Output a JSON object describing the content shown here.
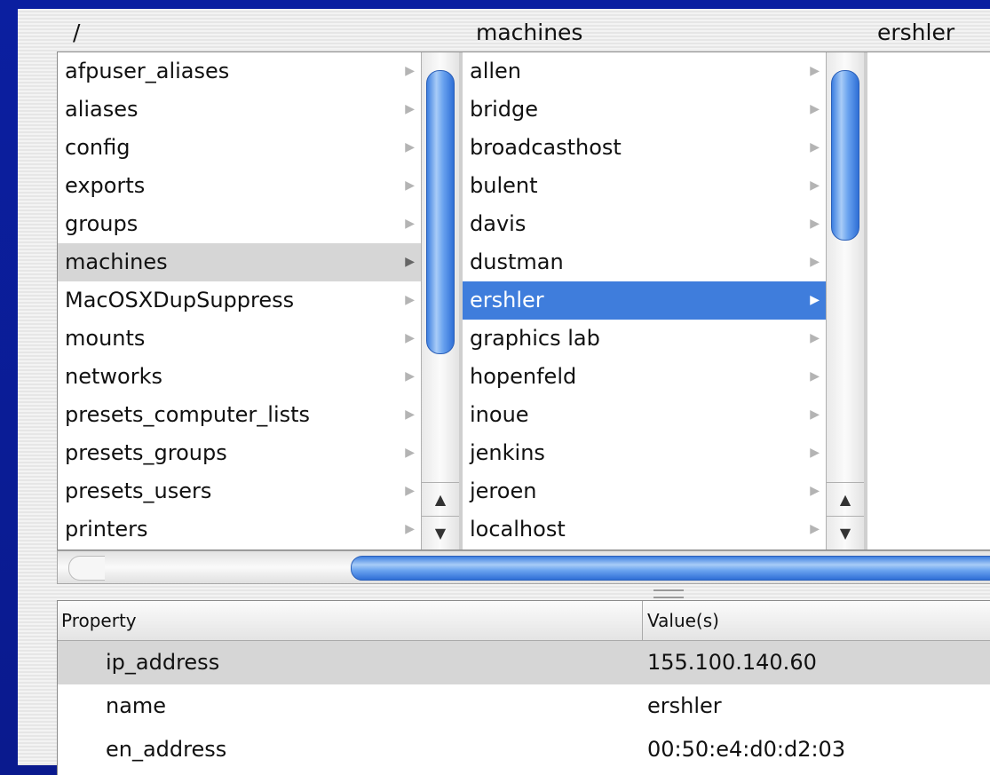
{
  "browser": {
    "column_headers": [
      "/",
      "machines",
      "ershler"
    ],
    "col1": {
      "items": [
        {
          "label": "afpuser_aliases"
        },
        {
          "label": "aliases"
        },
        {
          "label": "config"
        },
        {
          "label": "exports"
        },
        {
          "label": "groups"
        },
        {
          "label": "machines",
          "selected": true
        },
        {
          "label": "MacOSXDupSuppress"
        },
        {
          "label": "mounts"
        },
        {
          "label": "networks"
        },
        {
          "label": "presets_computer_lists"
        },
        {
          "label": "presets_groups"
        },
        {
          "label": "presets_users"
        },
        {
          "label": "printers"
        }
      ]
    },
    "col2": {
      "items": [
        {
          "label": "allen"
        },
        {
          "label": "bridge"
        },
        {
          "label": "broadcasthost"
        },
        {
          "label": "bulent"
        },
        {
          "label": "davis"
        },
        {
          "label": "dustman"
        },
        {
          "label": "ershler",
          "selected": true
        },
        {
          "label": "graphics lab"
        },
        {
          "label": "hopenfeld"
        },
        {
          "label": "inoue"
        },
        {
          "label": "jenkins"
        },
        {
          "label": "jeroen"
        },
        {
          "label": "localhost"
        }
      ]
    },
    "arrow_glyph": "▶",
    "scroll_up_glyph": "▲",
    "scroll_down_glyph": "▼"
  },
  "properties": {
    "headers": {
      "property": "Property",
      "values": "Value(s)"
    },
    "rows": [
      {
        "property": "ip_address",
        "value": "155.100.140.60",
        "selected": true
      },
      {
        "property": "name",
        "value": "ershler"
      },
      {
        "property": "en_address",
        "value": "00:50:e4:d0:d2:03"
      }
    ]
  },
  "colors": {
    "desktop_bg": "#0a1a8e",
    "selection_blue": "#3f7ddc",
    "selection_gray": "#d6d6d6",
    "scroll_thumb": "#4a8be6"
  }
}
